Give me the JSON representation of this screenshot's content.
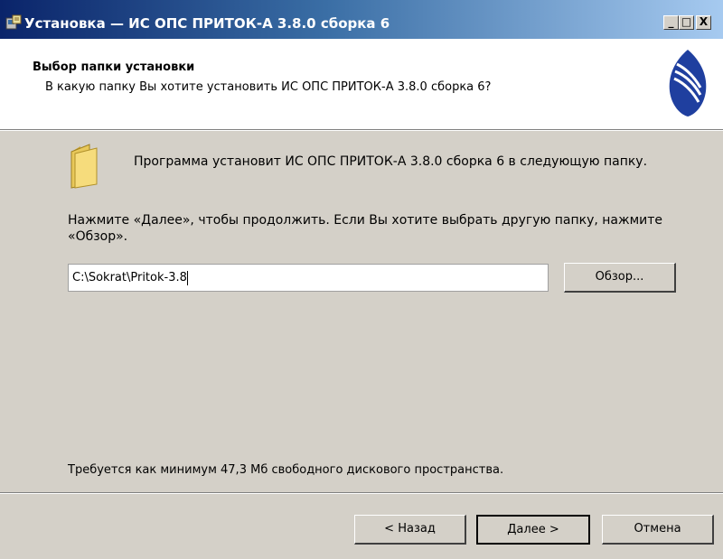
{
  "window": {
    "title": "Установка — ИС ОПС ПРИТОК-А 3.8.0 сборка 6",
    "minimize_glyph": "_",
    "maximize_glyph": "□",
    "close_glyph": "X"
  },
  "header": {
    "title": "Выбор папки установки",
    "subtitle": "В какую папку Вы хотите установить ИС ОПС ПРИТОК-А 3.8.0 сборка 6?",
    "logo_icon": "app-logo-icon"
  },
  "body": {
    "folder_icon": "folder-icon",
    "program_text": "Программа установит ИС ОПС ПРИТОК-А 3.8.0 сборка 6 в следующую папку.",
    "next_text": "Нажмите «Далее», чтобы продолжить. Если Вы хотите выбрать другую папку, нажмите «Обзор».",
    "path_value": "C:\\Sokrat\\Pritok-3.8",
    "browse_label": "Обзор...",
    "disk_text": "Требуется как минимум 47,3 Мб свободного дискового пространства."
  },
  "footer": {
    "back_label": "< Назад",
    "next_label": "Далее >",
    "cancel_label": "Отмена"
  },
  "colors": {
    "title_gradient_start": "#0a246a",
    "title_gradient_end": "#a6caf0",
    "dialog_bg": "#d4d0c8",
    "logo_blue": "#1f3f9f"
  }
}
